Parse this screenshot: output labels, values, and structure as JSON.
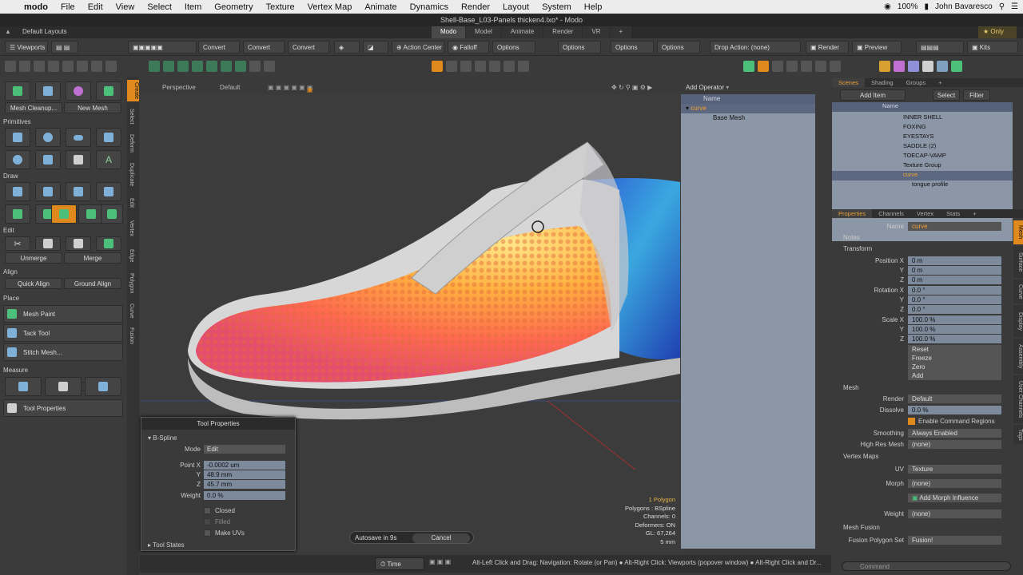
{
  "mac": {
    "apple": "",
    "app": "modo",
    "menus": [
      "File",
      "Edit",
      "View",
      "Select",
      "Item",
      "Geometry",
      "Texture",
      "Vertex Map",
      "Animate",
      "Dynamics",
      "Render",
      "Layout",
      "System",
      "Help"
    ],
    "battery": "100%",
    "user": "John Bavaresco"
  },
  "window": {
    "title": "Shell-Base_L03-Panels thicken4.lxo* - Modo"
  },
  "layout": {
    "label": "Default Layouts",
    "tabs": [
      "Modo",
      "Model",
      "Animate",
      "Render",
      "VR",
      "+"
    ],
    "active_tab": "Modo",
    "only": "Only"
  },
  "toolbar": {
    "viewports": "Viewports",
    "convert1": "Convert",
    "convert2": "Convert",
    "convert3": "Convert",
    "action_center": "Action Center",
    "falloff": "Falloff",
    "options1": "Options",
    "options2": "Options",
    "options3": "Options",
    "options4": "Options",
    "drop_action": "Drop Action: (none)",
    "render": "Render",
    "preview": "Preview",
    "kits": "Kits"
  },
  "left": {
    "mesh_cleanup": "Mesh Cleanup...",
    "new_mesh": "New Mesh",
    "primitives": "Primitives",
    "draw": "Draw",
    "edit": "Edit",
    "unmerge": "Unmerge",
    "merge": "Merge",
    "align": "Align",
    "quick_align": "Quick Align",
    "ground_align": "Ground Align",
    "place": "Place",
    "mesh_paint": "Mesh Paint",
    "tack_tool": "Tack Tool",
    "stitch_mesh": "Stitch Mesh...",
    "measure": "Measure",
    "tool_properties": "Tool Properties"
  },
  "vtabs": [
    "Create",
    "Select",
    "Deform",
    "Duplicate",
    "Edit",
    "Vertex",
    "Edge",
    "Polygon",
    "Curve",
    "Fusion"
  ],
  "viewport": {
    "view": "Perspective",
    "style": "Default",
    "stats": [
      "1 Polygon",
      "Polygons : BSpline",
      "Channels: 0",
      "Deformers: ON",
      "GL: 67,264",
      "5 mm"
    ]
  },
  "tool_props": {
    "title": "Tool Properties",
    "section": "B-Spline",
    "mode_label": "Mode",
    "mode_value": "Edit",
    "px_label": "Point X",
    "px": "-0.0002 um",
    "py_label": "Y",
    "py": "48.9 mm",
    "pz_label": "Z",
    "pz": "45.7 mm",
    "weight_label": "Weight",
    "weight": "0.0 %",
    "closed": "Closed",
    "filled": "Filled",
    "make_uvs": "Make UVs",
    "tool_states": "Tool States"
  },
  "autosave": {
    "text": "Autosave in 9s",
    "cancel": "Cancel"
  },
  "status": {
    "time": "Time",
    "message": "Alt-Left Click and Drag: Navigation: Rotate (or Pan) ● Alt-Right Click: Viewports (popover window) ● Alt-Right Click and Dr..."
  },
  "operators": {
    "add_operator": "Add Operator",
    "name_col": "Name",
    "curve": "curve",
    "base_mesh": "Base Mesh"
  },
  "scenes": {
    "tabs": [
      "Scenes",
      "Shading",
      "Groups",
      "+"
    ],
    "add_item": "Add Item",
    "select": "Select",
    "filter": "Filter",
    "name_col": "Name",
    "items": [
      "INNER SHELL",
      "FOXING",
      "EYESTAYS",
      "SADDLE (2)",
      "TOECAP-VAMP",
      "Texture Group",
      "curve",
      "tongue profile"
    ]
  },
  "props": {
    "tabs": [
      "Properties",
      "Channels",
      "Vertex",
      "Stats",
      "+"
    ],
    "name_label": "Name",
    "name": "curve",
    "notes": "Notes",
    "transform": "Transform",
    "pos_label": "Position X",
    "px": "0 m",
    "py": "0 m",
    "pz": "0 m",
    "rot_label": "Rotation X",
    "rx": "0.0 °",
    "ry": "0.0 °",
    "rz": "0.0 °",
    "scale_label": "Scale X",
    "sx": "100.0 %",
    "sy": "100.0 %",
    "sz": "100.0 %",
    "y": "Y",
    "z": "Z",
    "reset": "Reset",
    "freeze": "Freeze",
    "zero": "Zero",
    "add": "Add",
    "mesh": "Mesh",
    "render_label": "Render",
    "render": "Default",
    "dissolve_label": "Dissolve",
    "dissolve": "0.0 %",
    "enable_cmd": "Enable Command Regions",
    "smoothing_label": "Smoothing",
    "smoothing": "Always Enabled",
    "highres_label": "High Res Mesh",
    "highres": "(none)",
    "vmaps": "Vertex Maps",
    "uv_label": "UV",
    "uv": "Texture",
    "morph_label": "Morph",
    "morph": "(none)",
    "add_morph": "Add Morph Influence",
    "weight_label": "Weight",
    "weight": "(none)",
    "fusion": "Mesh Fusion",
    "fusion_label": "Fusion Polygon Set",
    "fusion_val": "Fusion!",
    "command": "Command"
  },
  "rvtabs": [
    "Mesh",
    "Surface",
    "Curve",
    "Display",
    "Assembly",
    "User Channels",
    "Tags"
  ]
}
